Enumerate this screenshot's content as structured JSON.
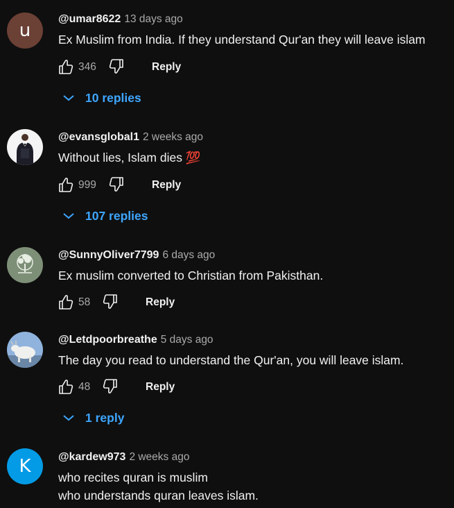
{
  "comments": [
    {
      "author": "@umar8622",
      "time": "13 days ago",
      "avatar_letter": "u",
      "avatar_color": "#6b4035",
      "text": "Ex Muslim from India. If they understand Qur'an they will leave islam",
      "likes": "346",
      "reply_label": "Reply",
      "replies_label": "10 replies"
    },
    {
      "author": "@evansglobal1",
      "time": "2 weeks ago",
      "avatar_color": "#f4f4f4",
      "text": "Without lies, Islam dies 💯",
      "likes": "999",
      "reply_label": "Reply",
      "replies_label": "107 replies"
    },
    {
      "author": "@SunnyOliver7799",
      "time": "6 days ago",
      "avatar_color": "#7e8f78",
      "text": "Ex muslim converted to Christian from Pakisthan.",
      "likes": "58",
      "reply_label": "Reply"
    },
    {
      "author": "@Letdpoorbreathe",
      "time": "5 days ago",
      "avatar_color": "#8fb3dd",
      "text": "The day you read to understand the Qur'an, you will leave islam.",
      "likes": "48",
      "reply_label": "Reply",
      "replies_label": "1 reply"
    },
    {
      "author": "@kardew973",
      "time": "2 weeks ago",
      "avatar_letter": "K",
      "avatar_color": "#039be5",
      "text_line1": "who recites quran is muslim",
      "text_line2": "who understands quran leaves islam."
    }
  ],
  "theme": {
    "background": "#0f0f0f",
    "link": "#3ea6ff",
    "secondary_text": "#aaaaaa"
  }
}
